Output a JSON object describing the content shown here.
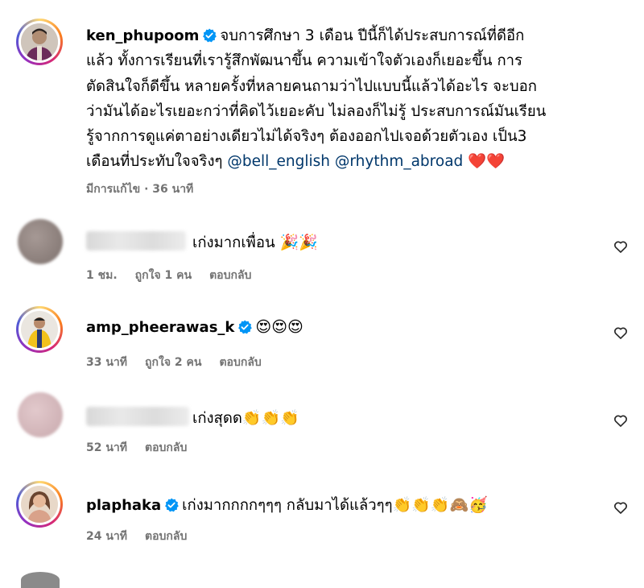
{
  "post": {
    "username": "ken_phupoom",
    "caption_lines": [
      "จบการศึกษา 3 เดือน ปีนี้ก็ได้ประสบการณ์ที่ดีอีก",
      "แล้ว ทั้งการเรียนที่เรารู้สึกพัฒนาขึ้น ความเข้าใจตัวเองก็เยอะขึ้น การ",
      "ตัดสินใจก็ดีขึ้น หลายครั้งที่หลายคนถามว่าไปแบบนี้แล้วได้อะไร จะบอก",
      "ว่ามันได้อะไรเยอะกว่าที่คิดไว้เยอะคับ ไม่ลองก็ไม่รู้ ประสบการณ์มันเรียน",
      "รู้จากการดูแค่ตาอย่างเดียวไม่ได้จริงๆ ต้องออกไปเจอด้วยตัวเอง เป็น3",
      "เดือนที่ประทับใจจริงๆ "
    ],
    "mention_1": "@bell_english",
    "mention_2": "@rhythm_abroad",
    "caption_emoji": "❤️❤️",
    "meta": "มีการแก้ไข · 36 นาที"
  },
  "comments": [
    {
      "username": "",
      "text": "เก่งมากเพื่อน ",
      "emoji": "🎉🎉",
      "time": "1 ชม.",
      "likes": "ถูกใจ 1 คน",
      "reply": "ตอบกลับ"
    },
    {
      "username": "amp_pheerawas_k",
      "text": "",
      "emoji": "😍😍😍",
      "time": "33 นาที",
      "likes": "ถูกใจ 2 คน",
      "reply": "ตอบกลับ"
    },
    {
      "username": "",
      "text": "เก่งสุดด",
      "emoji": "👏👏👏",
      "time": "52 นาที",
      "reply": "ตอบกลับ"
    },
    {
      "username": "plaphaka",
      "text": "เก่งมากกกกๆๆๆ กลับมาได้แล้วๆๆ",
      "emoji": "👏👏👏🙈🥳",
      "time": "24 นาที",
      "reply": "ตอบกลับ"
    }
  ],
  "icons": {
    "like": "heart-outline-icon",
    "verified": "verified-badge-icon"
  },
  "colors": {
    "verified": "#0095f6",
    "mention": "#00376b",
    "meta": "#737373",
    "heart": "#ed1c24"
  }
}
